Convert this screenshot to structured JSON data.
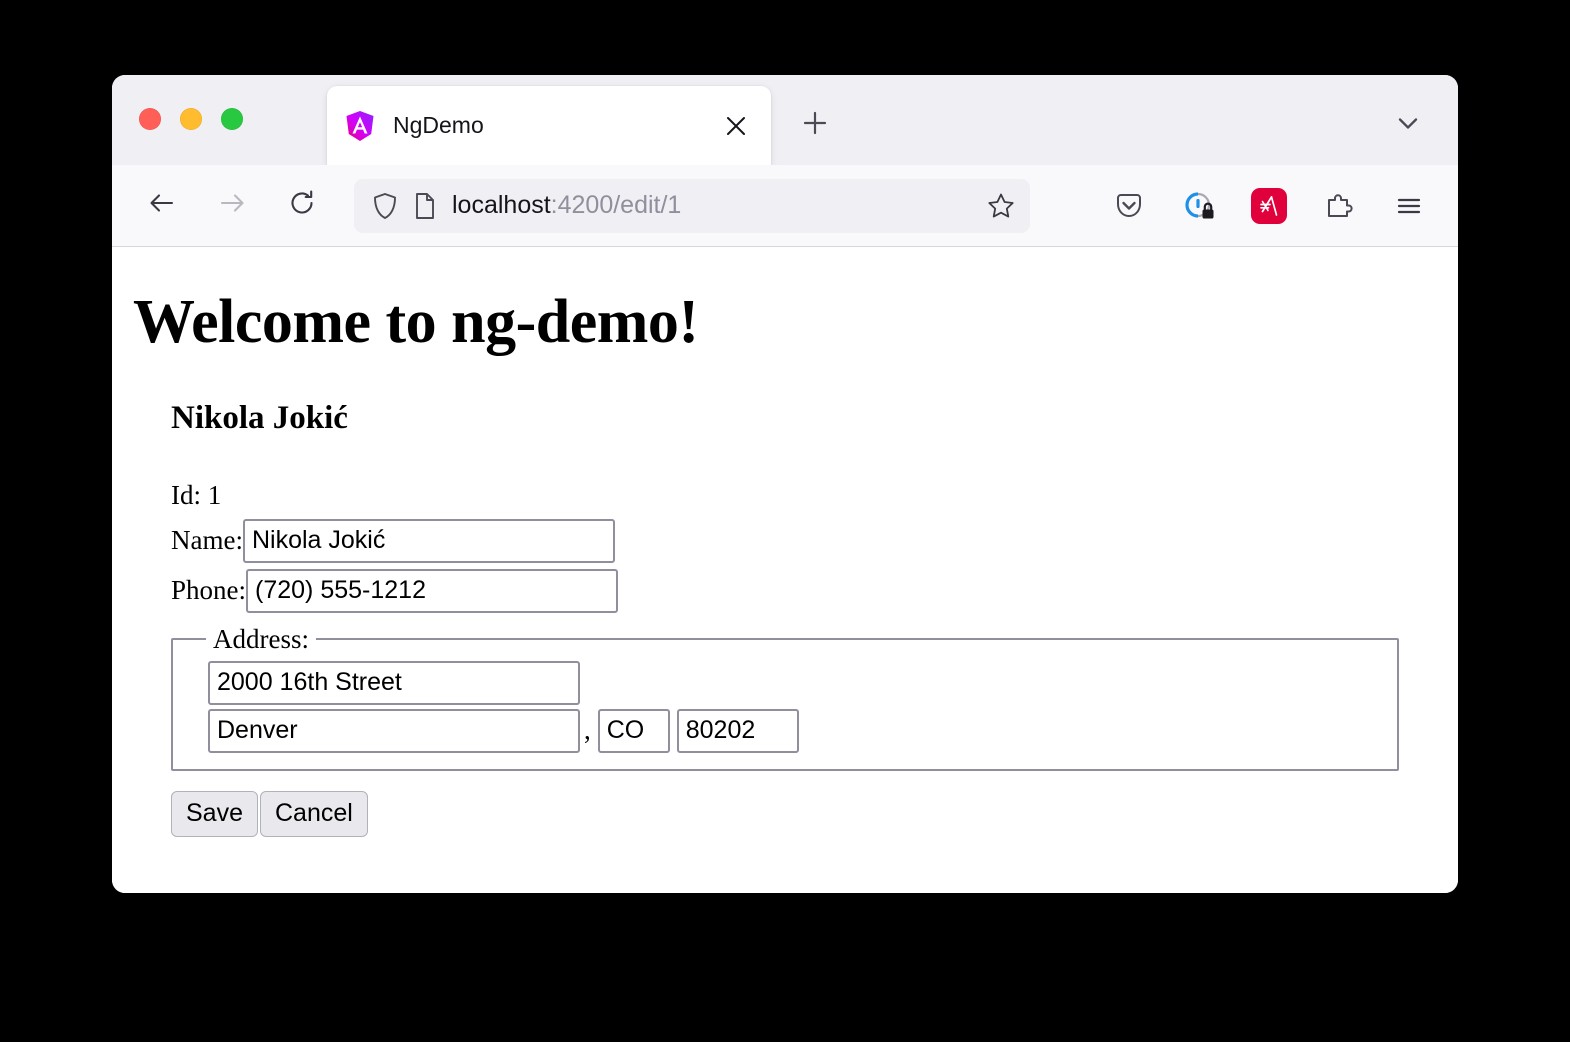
{
  "browser": {
    "window_controls": {
      "close_label": "close",
      "minimize_label": "minimize",
      "maximize_label": "maximize"
    },
    "tab": {
      "title": "NgDemo",
      "favicon": "angular-logo-icon",
      "close_icon": "close-icon"
    },
    "new_tab_icon": "plus-icon",
    "tab_list_icon": "chevron-down-icon",
    "nav": {
      "back_icon": "arrow-left-icon",
      "forward_icon": "arrow-right-icon",
      "reload_icon": "reload-icon"
    },
    "urlbar": {
      "shield_icon": "shield-icon",
      "page_icon": "page-document-icon",
      "host": "localhost",
      "path": ":4200/edit/1",
      "full_url": "localhost:4200/edit/1",
      "bookmark_icon": "star-icon"
    },
    "toolbar_icons": [
      {
        "name": "pocket-icon",
        "label": "Pocket"
      },
      {
        "name": "privacy-lock-icon",
        "label": "Privacy Badger"
      },
      {
        "name": "angular-devtools-icon",
        "label": "A",
        "color": "#e0003c"
      },
      {
        "name": "puzzle-extensions-icon",
        "label": "Extensions"
      },
      {
        "name": "hamburger-menu-icon",
        "label": "Application Menu"
      }
    ]
  },
  "page": {
    "title": "Welcome to ng-demo!",
    "person_name": "Nikola Jokić",
    "fields": {
      "id_label": "Id: ",
      "id_value": "1",
      "name_label": "Name:",
      "name_value": "Nikola Jokić",
      "phone_label": "Phone:",
      "phone_value": "(720) 555-1212"
    },
    "address": {
      "legend": "Address:",
      "street_value": "2000 16th Street",
      "city_value": "Denver",
      "separator": ",",
      "state_value": "CO",
      "zip_value": "80202"
    },
    "buttons": {
      "save_label": "Save",
      "cancel_label": "Cancel"
    }
  },
  "colors": {
    "traffic_red": "#ff5f57",
    "traffic_yellow": "#febc2e",
    "traffic_green": "#28c840",
    "chrome_bg": "#f0eff4",
    "navbar_bg": "#f9f9fb",
    "urlbar_bg": "#f0f0f4",
    "input_border": "#8f8f9d",
    "button_bg": "#e9e9ed",
    "ext_accent": "#e0003c"
  }
}
